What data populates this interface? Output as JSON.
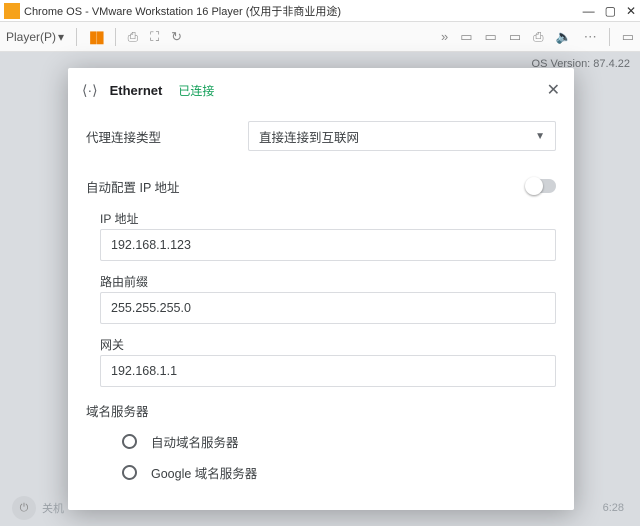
{
  "window": {
    "title": "Chrome OS - VMware Workstation 16 Player (仅用于非商业用途)",
    "player_button": "Player(P)"
  },
  "guest": {
    "os_version": "OS Version: 87.4.22",
    "shutdown_label": "关机",
    "clock": "6:28"
  },
  "modal": {
    "title": "Ethernet",
    "status": "已连接",
    "proxy_label": "代理连接类型",
    "proxy_value": "直接连接到互联网",
    "auto_ip_label": "自动配置 IP 地址",
    "fields": {
      "ip_label": "IP 地址",
      "ip_value": "192.168.1.123",
      "prefix_label": "路由前缀",
      "prefix_value": "255.255.255.0",
      "gateway_label": "网关",
      "gateway_value": "192.168.1.1"
    },
    "dns_label": "域名服务器",
    "dns_options": {
      "auto": "自动域名服务器",
      "google": "Google 域名服务器"
    }
  }
}
